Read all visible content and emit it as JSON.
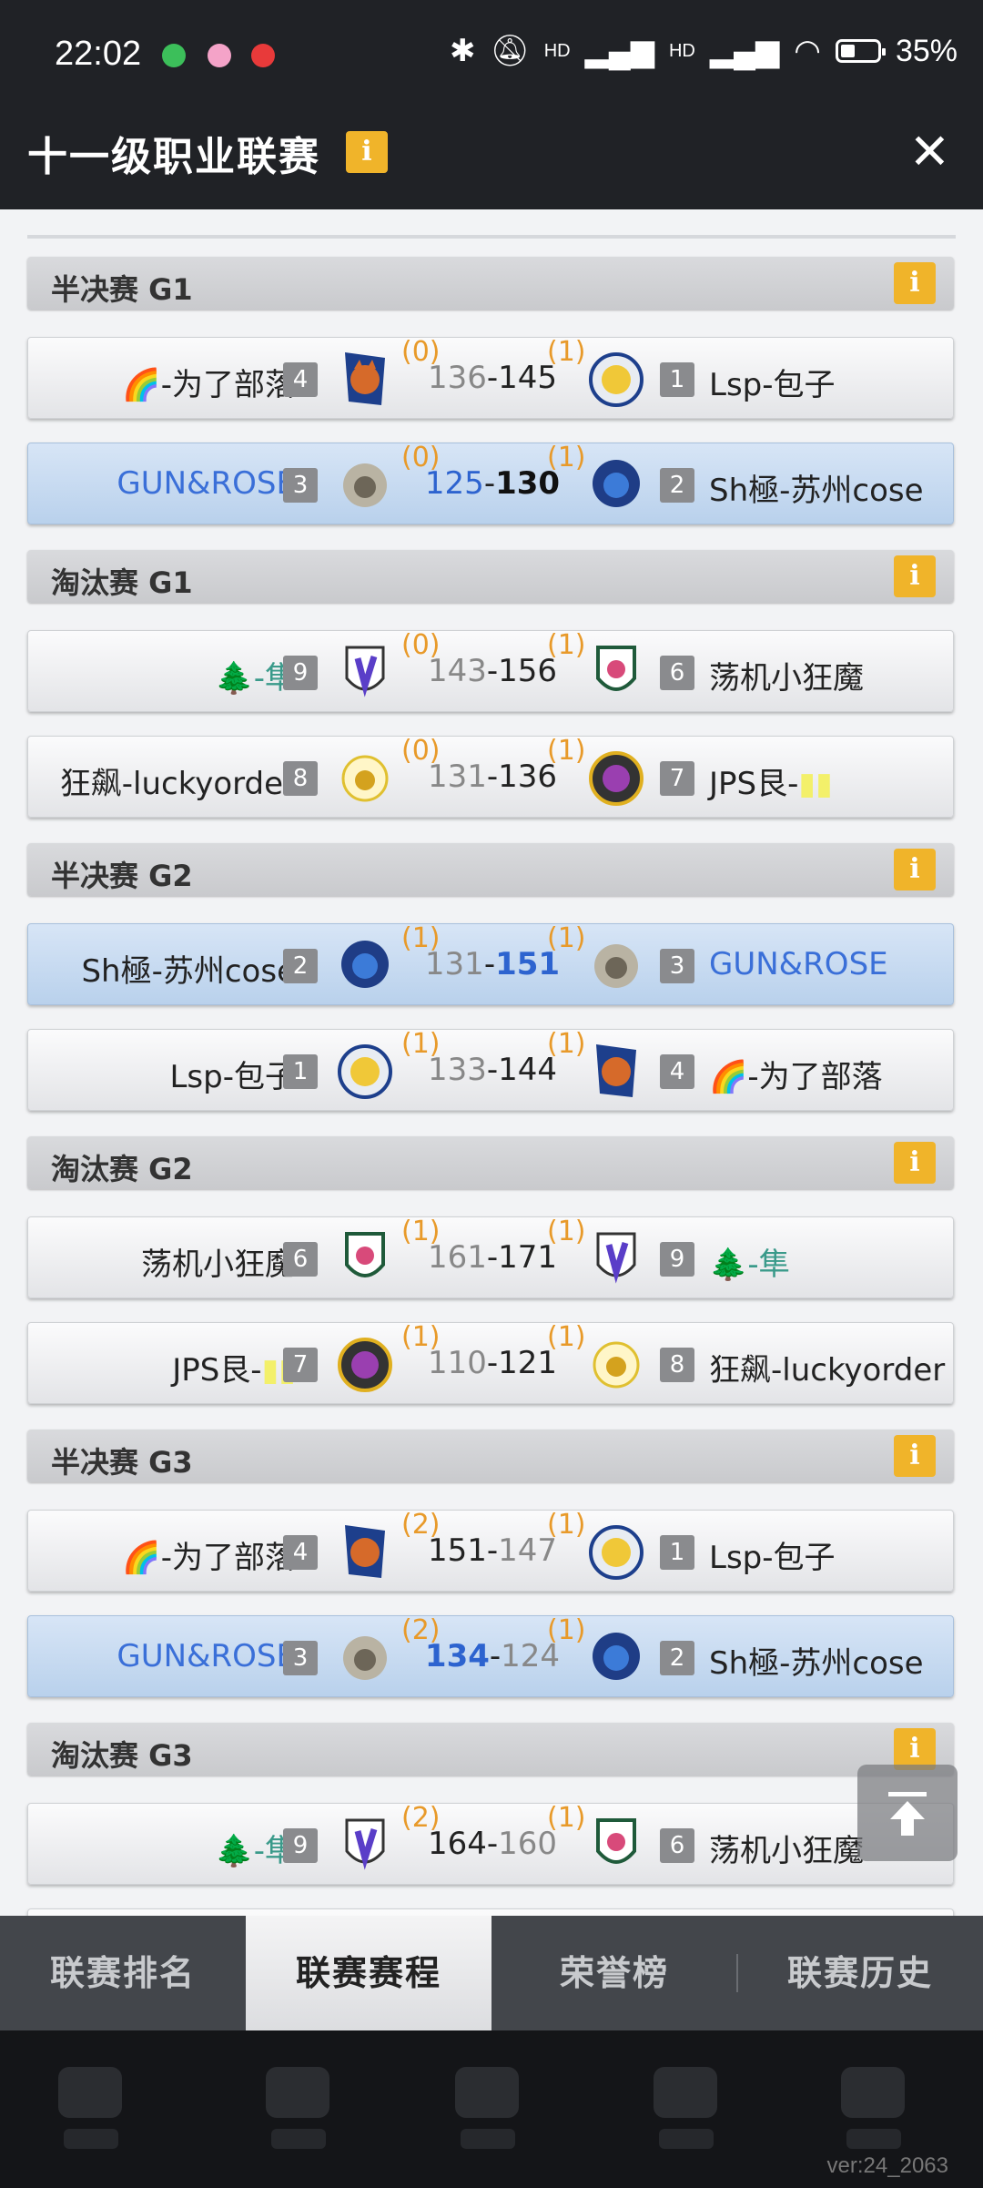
{
  "status_bar": {
    "time": "22:02",
    "battery_percent": "35%",
    "network_1": "HD",
    "network_2": "HD"
  },
  "header": {
    "title": "十一级职业联赛",
    "info_icon": "i",
    "close_icon": "✕"
  },
  "sections": [
    {
      "label": "半决赛 G1"
    },
    {
      "label": "淘汰赛 G1"
    },
    {
      "label": "半决赛 G2"
    },
    {
      "label": "淘汰赛 G2"
    },
    {
      "label": "半决赛 G3"
    },
    {
      "label": "淘汰赛 G3"
    }
  ],
  "matches": [
    {
      "left": {
        "name": "-为了部落",
        "emoji": "🌈",
        "seed": "4",
        "wins": "(0)"
      },
      "right": {
        "name": "Lsp-包子",
        "seed": "1",
        "wins": "(1)"
      },
      "score_left": "136",
      "score_right": "145"
    },
    {
      "left": {
        "name": "GUN&ROSE",
        "seed": "3",
        "wins": "(0)"
      },
      "right": {
        "name": "Sh極-苏州cose",
        "seed": "2",
        "wins": "(1)"
      },
      "score_left": "125",
      "score_right": "130"
    },
    {
      "left": {
        "name": "-隼",
        "emoji": "🌲",
        "seed": "9",
        "wins": "(0)"
      },
      "right": {
        "name": "荡机小狂魔",
        "seed": "6",
        "wins": "(1)"
      },
      "score_left": "143",
      "score_right": "156"
    },
    {
      "left": {
        "name": "狂飙-luckyorder",
        "seed": "8",
        "wins": "(0)"
      },
      "right": {
        "name": "JPS艮-",
        "seed": "7",
        "wins": "(1)"
      },
      "score_left": "131",
      "score_right": "136"
    },
    {
      "left": {
        "name": "Sh極-苏州cose",
        "seed": "2",
        "wins": "(1)"
      },
      "right": {
        "name": "GUN&ROSE",
        "seed": "3",
        "wins": "(1)"
      },
      "score_left": "131",
      "score_right": "151"
    },
    {
      "left": {
        "name": "Lsp-包子",
        "seed": "1",
        "wins": "(1)"
      },
      "right": {
        "name": "-为了部落",
        "emoji": "🌈",
        "seed": "4",
        "wins": "(1)"
      },
      "score_left": "133",
      "score_right": "144"
    },
    {
      "left": {
        "name": "荡机小狂魔",
        "seed": "6",
        "wins": "(1)"
      },
      "right": {
        "name": "-隼",
        "emoji": "🌲",
        "seed": "9",
        "wins": "(1)"
      },
      "score_left": "161",
      "score_right": "171"
    },
    {
      "left": {
        "name": "JPS艮-",
        "seed": "7",
        "wins": "(1)"
      },
      "right": {
        "name": "狂飙-luckyorder",
        "seed": "8",
        "wins": "(1)"
      },
      "score_left": "110",
      "score_right": "121"
    },
    {
      "left": {
        "name": "-为了部落",
        "emoji": "🌈",
        "seed": "4",
        "wins": "(2)"
      },
      "right": {
        "name": "Lsp-包子",
        "seed": "1",
        "wins": "(1)"
      },
      "score_left": "151",
      "score_right": "147"
    },
    {
      "left": {
        "name": "GUN&ROSE",
        "seed": "3",
        "wins": "(2)"
      },
      "right": {
        "name": "Sh極-苏州cose",
        "seed": "2",
        "wins": "(1)"
      },
      "score_left": "134",
      "score_right": "124"
    },
    {
      "left": {
        "name": "-隼",
        "emoji": "🌲",
        "seed": "9",
        "wins": "(2)"
      },
      "right": {
        "name": "荡机小狂魔",
        "seed": "6",
        "wins": "(1)"
      },
      "score_left": "164",
      "score_right": "160"
    }
  ],
  "tabs": [
    {
      "label": "联赛排名"
    },
    {
      "label": "联赛赛程"
    },
    {
      "label": "荣誉榜"
    },
    {
      "label": "联赛历史"
    }
  ],
  "version": "ver:24_2063",
  "colors": {
    "accent_orange": "#f0b42a",
    "wins_orange": "#e89a2a",
    "team_blue": "#3a6fd8",
    "highlight_row": "#c9dcf1"
  }
}
